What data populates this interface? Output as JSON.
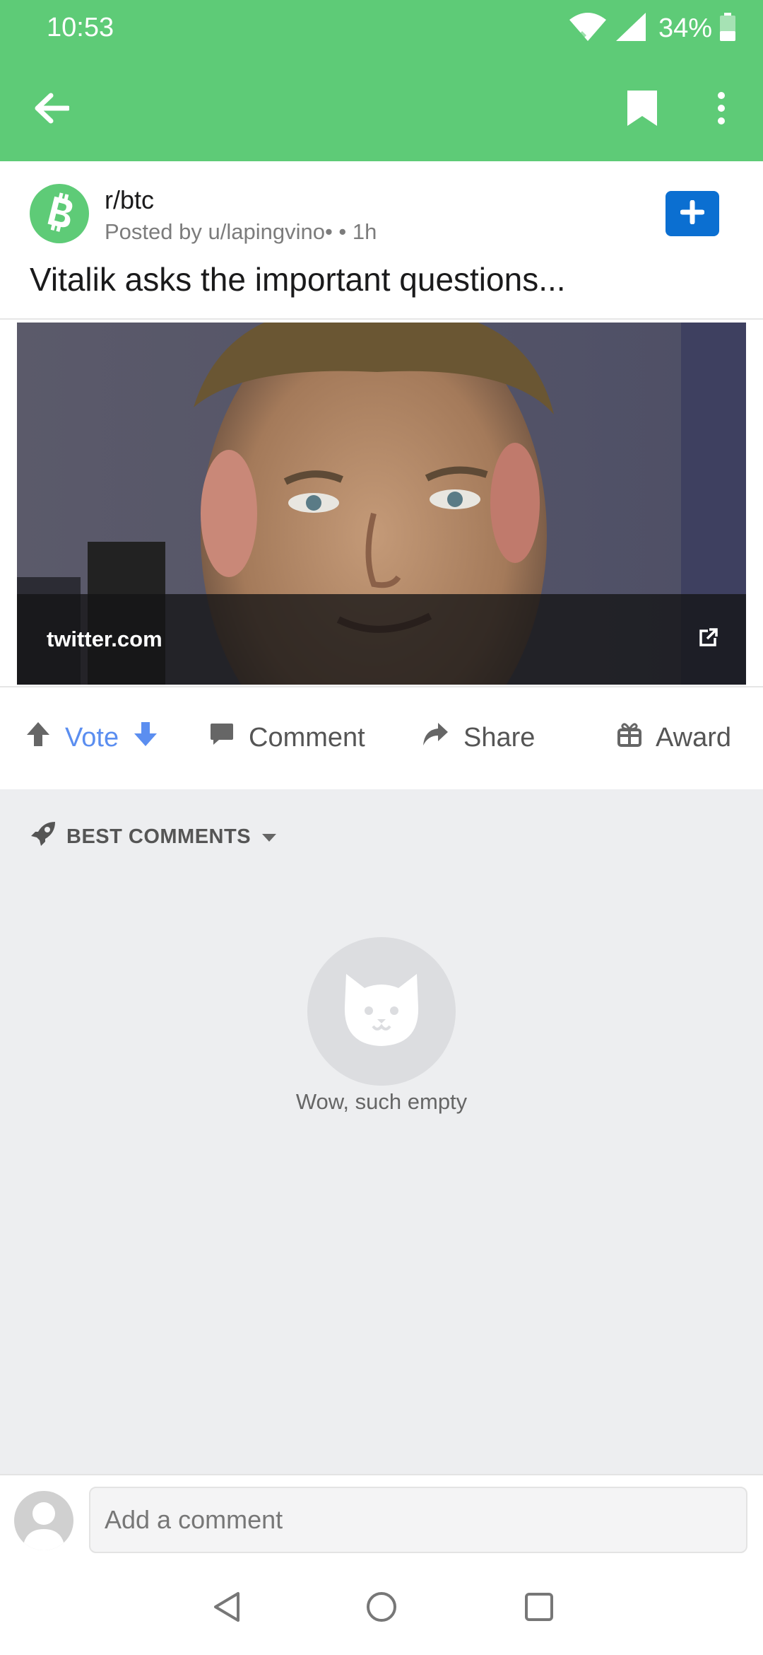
{
  "status_bar": {
    "time": "10:53",
    "battery": "34%"
  },
  "app_bar": {
    "back_icon": "arrow-left-icon",
    "bookmark_icon": "bookmark-icon",
    "more_icon": "more-vertical-icon"
  },
  "post": {
    "subreddit": "r/btc",
    "posted_by": "Posted by u/lapingvino•",
    "age": "• 1h",
    "title": "Vitalik asks the important questions...",
    "link_domain": "twitter.com"
  },
  "actions": {
    "vote": "Vote",
    "comment": "Comment",
    "share": "Share",
    "award": "Award"
  },
  "comments": {
    "sort_label": "BEST COMMENTS",
    "empty_message": "Wow, such empty"
  },
  "comment_bar": {
    "placeholder": "Add a comment"
  },
  "colors": {
    "header": "#5ecb77",
    "accent_blue": "#0b6fd1",
    "vote_blue": "#5b8ef0",
    "background": "#edeef0"
  }
}
